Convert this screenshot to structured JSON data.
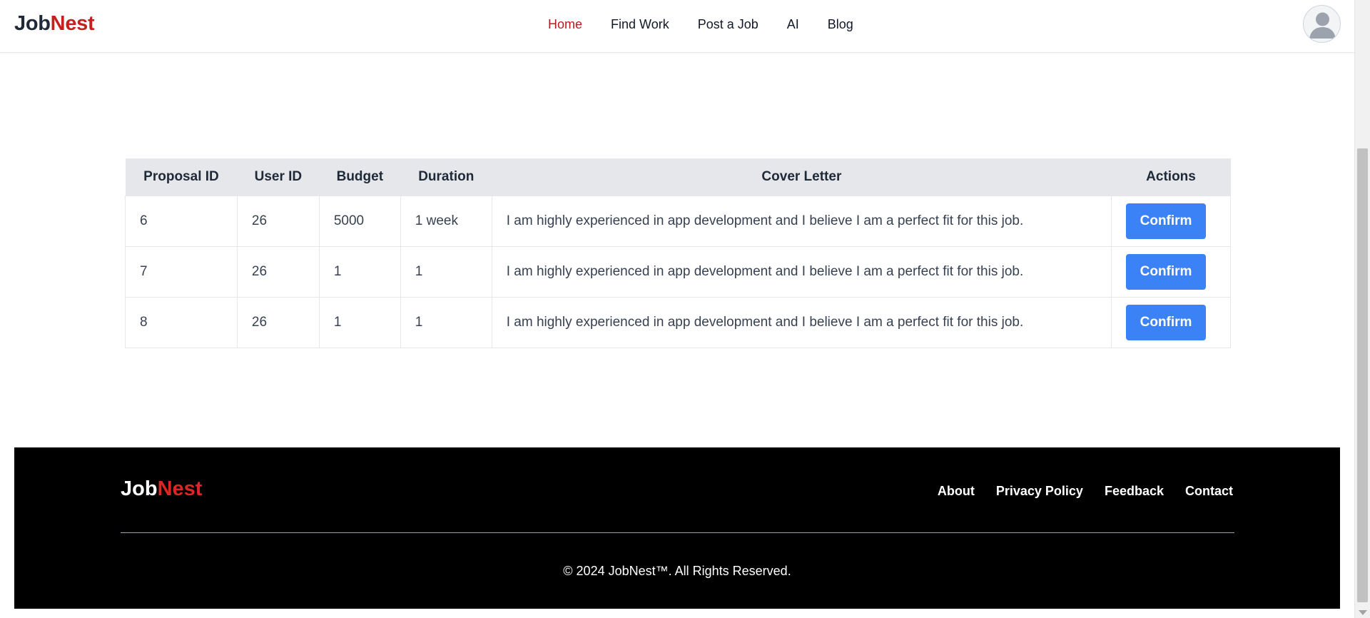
{
  "header": {
    "logo_part1": "Job",
    "logo_part2": "Nest",
    "nav": [
      {
        "label": "Home",
        "active": true
      },
      {
        "label": "Find Work"
      },
      {
        "label": "Post a Job"
      },
      {
        "label": "AI"
      },
      {
        "label": "Blog"
      }
    ],
    "avatar_icon": "user-avatar-icon"
  },
  "table": {
    "headers": [
      "Proposal ID",
      "User ID",
      "Budget",
      "Duration",
      "Cover Letter",
      "Actions"
    ],
    "rows": [
      {
        "proposal_id": "6",
        "user_id": "26",
        "budget": "5000",
        "duration": "1 week",
        "cover_letter": "I am highly experienced in app development and I believe I am a perfect fit for this job.",
        "action_label": "Confirm"
      },
      {
        "proposal_id": "7",
        "user_id": "26",
        "budget": "1",
        "duration": "1",
        "cover_letter": "I am highly experienced in app development and I believe I am a perfect fit for this job.",
        "action_label": "Confirm"
      },
      {
        "proposal_id": "8",
        "user_id": "26",
        "budget": "1",
        "duration": "1",
        "cover_letter": "I am highly experienced in app development and I believe I am a perfect fit for this job.",
        "action_label": "Confirm"
      }
    ]
  },
  "footer": {
    "logo_part1": "Job",
    "logo_part2": "Nest",
    "links": [
      "About",
      "Privacy Policy",
      "Feedback",
      "Contact"
    ],
    "copyright": "© 2024 JobNest™. All Rights Reserved."
  },
  "colors": {
    "brand_red": "#c81e1e",
    "button_blue": "#3b82f6",
    "footer_bg": "#000000",
    "table_header_bg": "#e5e7eb"
  }
}
